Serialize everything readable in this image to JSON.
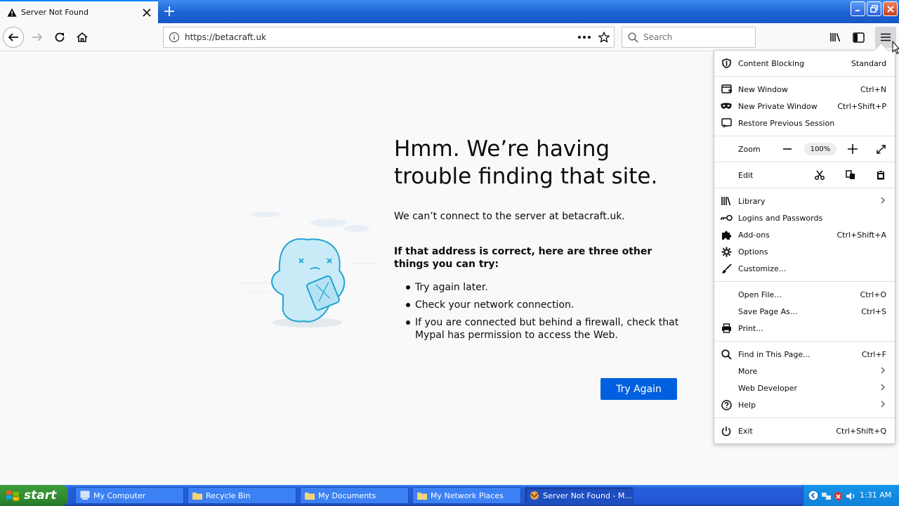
{
  "browser": {
    "tab": {
      "title": "Server Not Found"
    },
    "url": "https://betacraft.uk",
    "search_placeholder": "Search"
  },
  "error_page": {
    "title": "Hmm. We’re having trouble finding that site.",
    "message": "We can’t connect to the server at betacraft.uk.",
    "subtitle": "If that address is correct, here are three other things you can try:",
    "suggestions": [
      "Try again later.",
      "Check your network connection.",
      "If you are connected but behind a firewall, check that Mypal has permission to access the Web."
    ],
    "button_label": "Try Again"
  },
  "app_menu": {
    "content_blocking": {
      "label": "Content Blocking",
      "value": "Standard"
    },
    "new_window": {
      "label": "New Window",
      "shortcut": "Ctrl+N"
    },
    "new_private_window": {
      "label": "New Private Window",
      "shortcut": "Ctrl+Shift+P"
    },
    "restore_session": {
      "label": "Restore Previous Session"
    },
    "zoom": {
      "label": "Zoom",
      "value": "100%"
    },
    "edit": {
      "label": "Edit"
    },
    "library": {
      "label": "Library"
    },
    "logins": {
      "label": "Logins and Passwords"
    },
    "addons": {
      "label": "Add-ons",
      "shortcut": "Ctrl+Shift+A"
    },
    "options": {
      "label": "Options"
    },
    "customize": {
      "label": "Customize..."
    },
    "open_file": {
      "label": "Open File...",
      "shortcut": "Ctrl+O"
    },
    "save_page": {
      "label": "Save Page As...",
      "shortcut": "Ctrl+S"
    },
    "print": {
      "label": "Print..."
    },
    "find": {
      "label": "Find in This Page...",
      "shortcut": "Ctrl+F"
    },
    "more": {
      "label": "More"
    },
    "web_developer": {
      "label": "Web Developer"
    },
    "help": {
      "label": "Help"
    },
    "exit": {
      "label": "Exit",
      "shortcut": "Ctrl+Shift+Q"
    }
  },
  "taskbar": {
    "start_label": "start",
    "tasks": [
      "My Computer",
      "Recycle Bin",
      "My Documents",
      "My Network Places",
      "Server Not Found - M..."
    ],
    "clock": "1:31 AM"
  },
  "colors": {
    "accent": "#0060df",
    "taskbar": "#245edb",
    "start": "#308c2e"
  }
}
